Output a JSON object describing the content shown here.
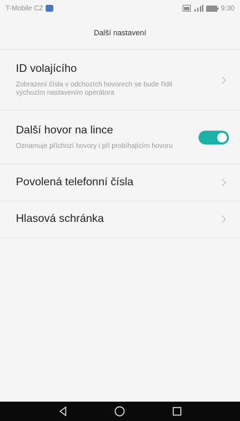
{
  "status_bar": {
    "carrier": "T-Mobile CZ",
    "time": "9:30"
  },
  "header": {
    "title": "Další nastavení"
  },
  "settings": [
    {
      "title": "ID volajícího",
      "subtitle": "Zobrazení čísla v odchozích hovorech se bude řídit výchozím nastavením operátora",
      "control": "chevron"
    },
    {
      "title": "Další hovor na lince",
      "subtitle": "Oznamuje příchozí hovory i při probíhajícím hovoru",
      "control": "toggle",
      "toggle_on": true
    },
    {
      "title": "Povolená telefonní čísla",
      "control": "chevron"
    },
    {
      "title": "Hlasová schránka",
      "control": "chevron"
    }
  ],
  "colors": {
    "accent": "#19b4a7",
    "background": "#f5f5f5",
    "nav_bar": "#0a0a0a"
  },
  "icons": {
    "status_left": "image-notification-icon",
    "status_right": [
      "gallery-icon",
      "signal-icon",
      "battery-icon"
    ],
    "nav": [
      "back-icon",
      "home-icon",
      "recents-icon"
    ]
  }
}
